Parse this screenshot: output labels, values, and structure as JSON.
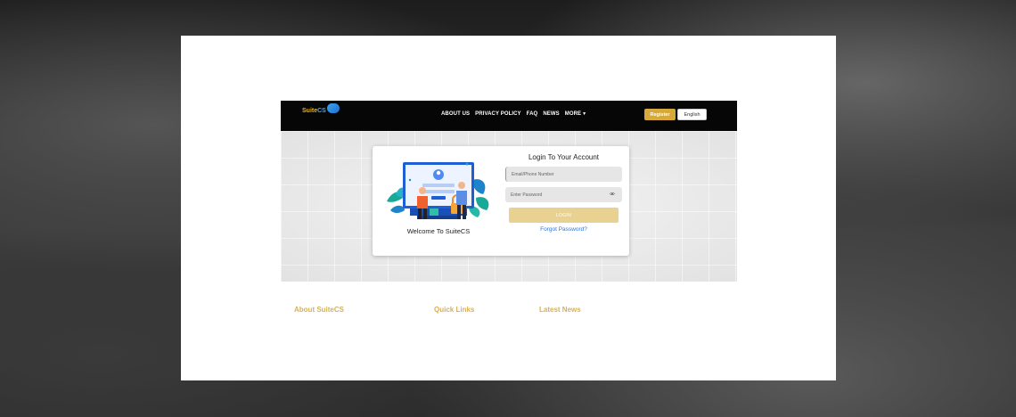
{
  "header": {
    "logo_text_main": "Suite",
    "logo_text_accent": "CS",
    "nav": [
      "ABOUT US",
      "PRIVACY POLICY",
      "FAQ",
      "NEWS",
      "MORE"
    ],
    "register_label": "Register",
    "language_label": "English"
  },
  "login": {
    "title": "Login To Your Account",
    "email_placeholder": "Email/Phone Number",
    "password_placeholder": "Enter Password",
    "login_label": "LOGIN",
    "forgot_label": "Forgot Password?",
    "welcome": "Welcome To SuiteCS"
  },
  "footer": {
    "about": "About SuiteCS",
    "quick_links": "Quick Links",
    "latest_news": "Latest News"
  },
  "colors": {
    "navbar": "#060606",
    "accent_gold": "#d7a93b",
    "login_button": "#e9d291",
    "link_blue": "#3b73c9",
    "footer_heading": "#d7b05a"
  }
}
